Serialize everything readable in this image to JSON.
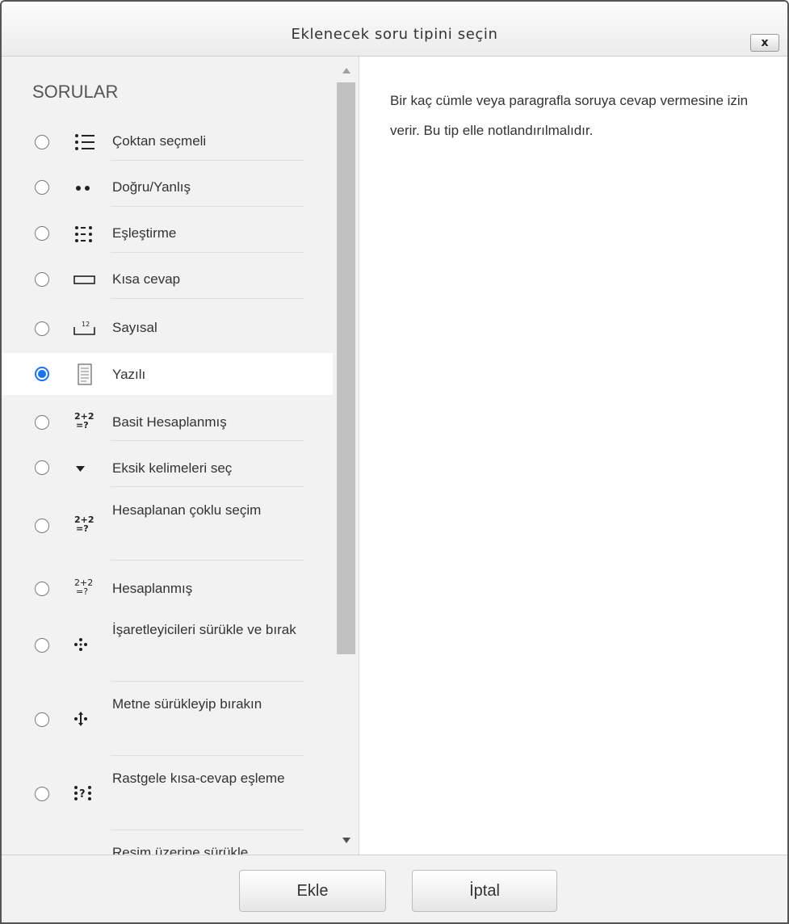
{
  "dialog": {
    "title": "Eklenecek soru tipini seçin",
    "close_label": "x"
  },
  "sidebar": {
    "section_header": "SORULAR",
    "items": [
      {
        "label": "Çoktan seçmeli",
        "icon": "multichoice-icon",
        "checked": false
      },
      {
        "label": "Doğru/Yanlış",
        "icon": "truefalse-icon",
        "checked": false
      },
      {
        "label": "Eşleştirme",
        "icon": "match-icon",
        "checked": false
      },
      {
        "label": "Kısa cevap",
        "icon": "shortanswer-icon",
        "checked": false
      },
      {
        "label": "Sayısal",
        "icon": "numerical-icon",
        "checked": false
      },
      {
        "label": "Yazılı",
        "icon": "essay-icon",
        "checked": true
      },
      {
        "label": "Basit Hesaplanmış",
        "icon": "calculatedsimple-icon",
        "checked": false
      },
      {
        "label": "Eksik kelimeleri seç",
        "icon": "gapselect-icon",
        "checked": false
      },
      {
        "label": "Hesaplanan çoklu seçim",
        "icon": "calculatedmulti-icon",
        "checked": false
      },
      {
        "label": "Hesaplanmış",
        "icon": "calculated-icon",
        "checked": false
      },
      {
        "label": "İşaretleyicileri sürükle ve bırak",
        "icon": "ddmarker-icon",
        "checked": false
      },
      {
        "label": "Metne sürükleyip bırakın",
        "icon": "ddwtos-icon",
        "checked": false
      },
      {
        "label": "Rastgele kısa-cevap eşleme",
        "icon": "randomsamatch-icon",
        "checked": false
      },
      {
        "label": "Resim üzerine sürükle",
        "icon": "ddimageortext-icon",
        "checked": false
      }
    ]
  },
  "description": {
    "text": "Bir kaç cümle veya paragrafla soruya cevap vermesine izin verir. Bu tip elle notlandırılmalıdır."
  },
  "footer": {
    "add_label": "Ekle",
    "cancel_label": "İptal"
  },
  "colors": {
    "accent": "#1a73e8",
    "panel_bg": "#f2f2f2"
  }
}
